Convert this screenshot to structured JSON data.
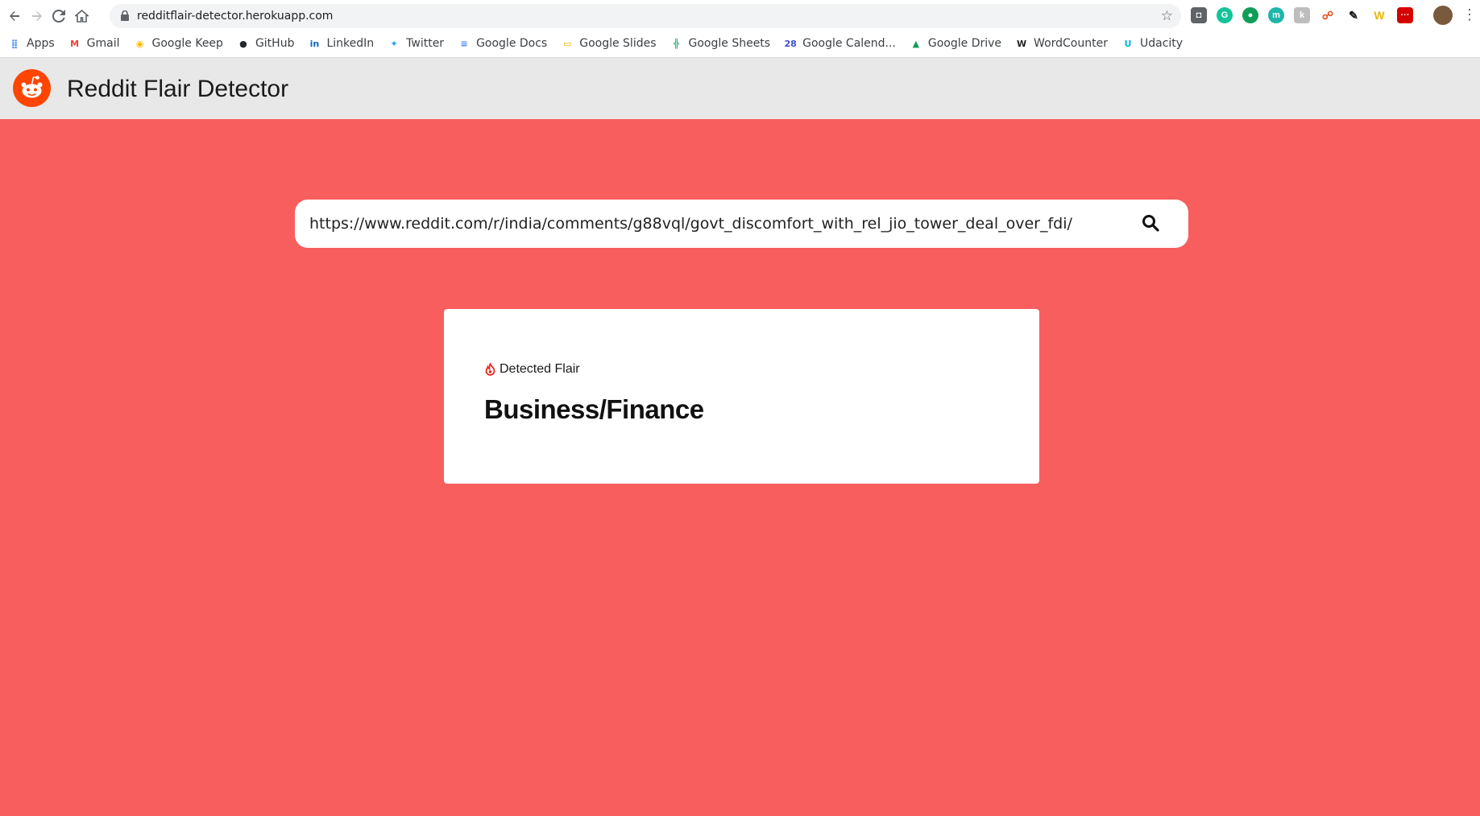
{
  "browser": {
    "url": "redditflair-detector.herokuapp.com",
    "bookmarks": [
      {
        "label": "Apps",
        "icon": "apps-grid-icon",
        "color": "#4285f4"
      },
      {
        "label": "Gmail",
        "icon": "gmail-icon",
        "color": "#ea4335"
      },
      {
        "label": "Google Keep",
        "icon": "google-keep-icon",
        "color": "#fbbc04"
      },
      {
        "label": "GitHub",
        "icon": "github-icon",
        "color": "#24292e"
      },
      {
        "label": "LinkedIn",
        "icon": "linkedin-icon",
        "color": "#0a66c2"
      },
      {
        "label": "Twitter",
        "icon": "twitter-icon",
        "color": "#1da1f2"
      },
      {
        "label": "Google Docs",
        "icon": "google-docs-icon",
        "color": "#4285f4"
      },
      {
        "label": "Google Slides",
        "icon": "google-slides-icon",
        "color": "#f4b400"
      },
      {
        "label": "Google Sheets",
        "icon": "google-sheets-icon",
        "color": "#0f9d58"
      },
      {
        "label": "Google Calend...",
        "icon": "google-calendar-icon",
        "color": "#3c4fd8"
      },
      {
        "label": "Google Drive",
        "icon": "google-drive-icon",
        "color": "#0f9d58"
      },
      {
        "label": "WordCounter",
        "icon": "wordcounter-icon",
        "color": "#222222"
      },
      {
        "label": "Udacity",
        "icon": "udacity-icon",
        "color": "#02b3e4"
      }
    ]
  },
  "app": {
    "title": "Reddit Flair Detector",
    "brand_color": "#ff4500",
    "background_color": "#f85e5e"
  },
  "search": {
    "value": "https://www.reddit.com/r/india/comments/g88vql/govt_discomfort_with_rel_jio_tower_deal_over_fdi/"
  },
  "result": {
    "label": "Detected Flair",
    "value": "Business/Finance"
  }
}
